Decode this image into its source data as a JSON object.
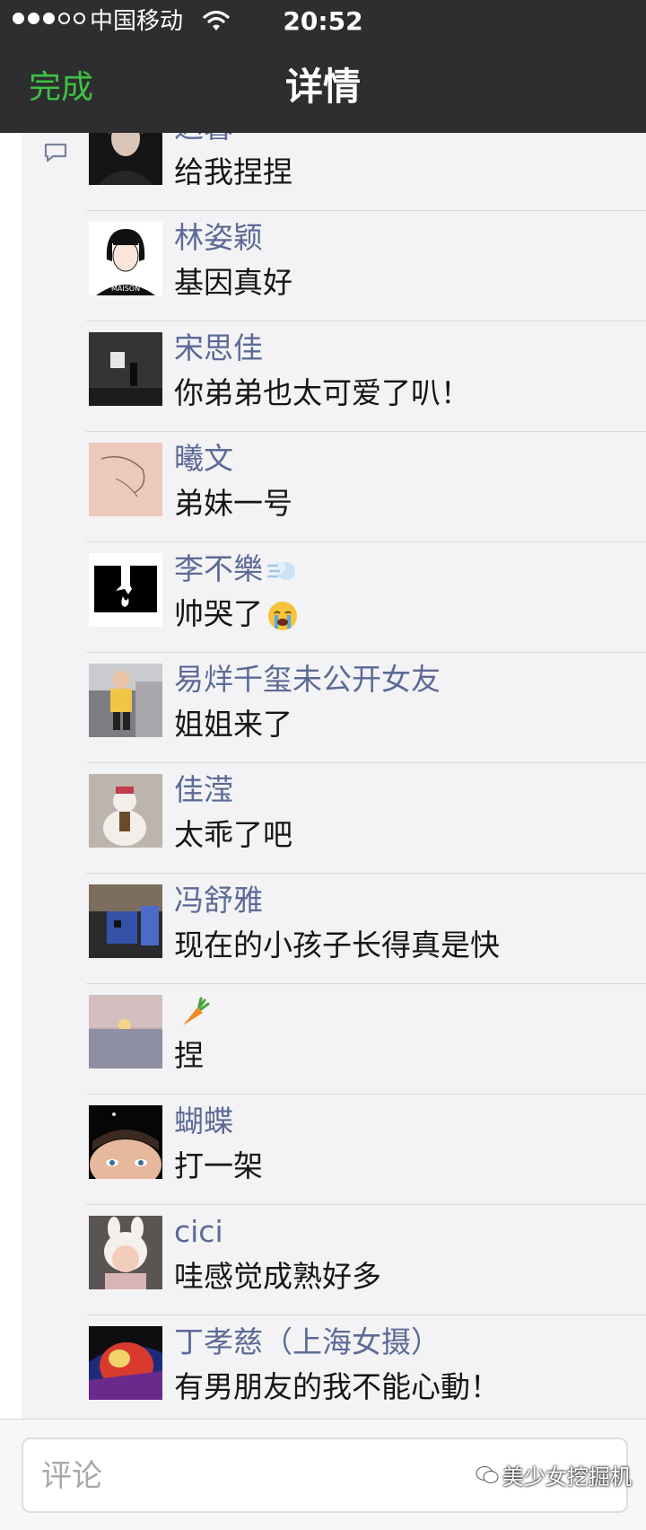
{
  "status_bar": {
    "carrier": "中国移动",
    "time": "20:52",
    "signal_filled": 3,
    "signal_total": 5
  },
  "nav": {
    "done_label": "完成",
    "title": "详情",
    "done_color": "#3ec245"
  },
  "comments": [
    {
      "name": "迟暮",
      "text": "给我捏捏",
      "avatar": "avatar-photo-woman"
    },
    {
      "name": "林姿颖",
      "text": "基因真好",
      "avatar": "avatar-illustration-girl",
      "avatar_text": "MAISON"
    },
    {
      "name": "宋思佳",
      "text": "你弟弟也太可爱了叭！",
      "avatar": "avatar-dark-room"
    },
    {
      "name": "曦文",
      "text": "弟妹一号",
      "avatar": "avatar-sketch"
    },
    {
      "name": "李不樂",
      "text": "帅哭了",
      "avatar": "avatar-black-hand",
      "name_emoji": "dash-emoji",
      "text_emoji": "crying-face-emoji"
    },
    {
      "name": "易烊千玺未公开女友",
      "text": "姐姐来了",
      "avatar": "avatar-child-yellow"
    },
    {
      "name": "佳滢",
      "text": "太乖了吧",
      "avatar": "avatar-snowman"
    },
    {
      "name": "冯舒雅",
      "text": "现在的小孩子长得真是快",
      "avatar": "avatar-blue-box"
    },
    {
      "name": "",
      "text": "捏",
      "avatar": "avatar-sunset",
      "name_emoji": "carrot-emoji"
    },
    {
      "name": "蝴蝶",
      "text": "打一架",
      "avatar": "avatar-face-closeup"
    },
    {
      "name": "cici",
      "text": "哇感觉成熟好多",
      "avatar": "avatar-bunny-hat"
    },
    {
      "name": "丁孝慈（上海女摄）",
      "text": "有男朋友的我不能心動！",
      "avatar": "avatar-colorful"
    }
  ],
  "input": {
    "placeholder": "评论"
  },
  "watermark": {
    "text": "美少女挖掘机"
  },
  "colors": {
    "nav_background": "#2e2e30",
    "name_link": "#5c6a96",
    "panel_background": "#f3f3f5"
  }
}
